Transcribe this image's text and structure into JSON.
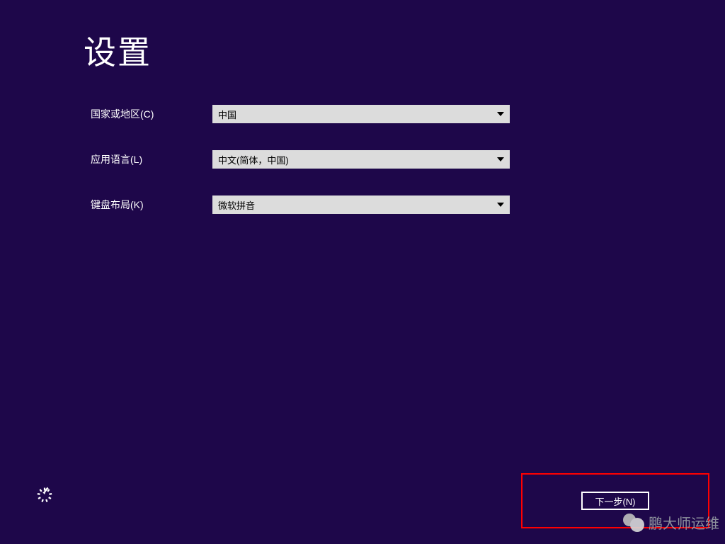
{
  "title": "设置",
  "fields": {
    "country": {
      "label": "国家或地区(C)",
      "value": "中国"
    },
    "language": {
      "label": "应用语言(L)",
      "value": "中文(简体，中国)"
    },
    "keyboard": {
      "label": "键盘布局(K)",
      "value": "微软拼音"
    }
  },
  "buttons": {
    "next": "下一步(N)"
  },
  "watermark": {
    "text": "鹏大师运维"
  }
}
